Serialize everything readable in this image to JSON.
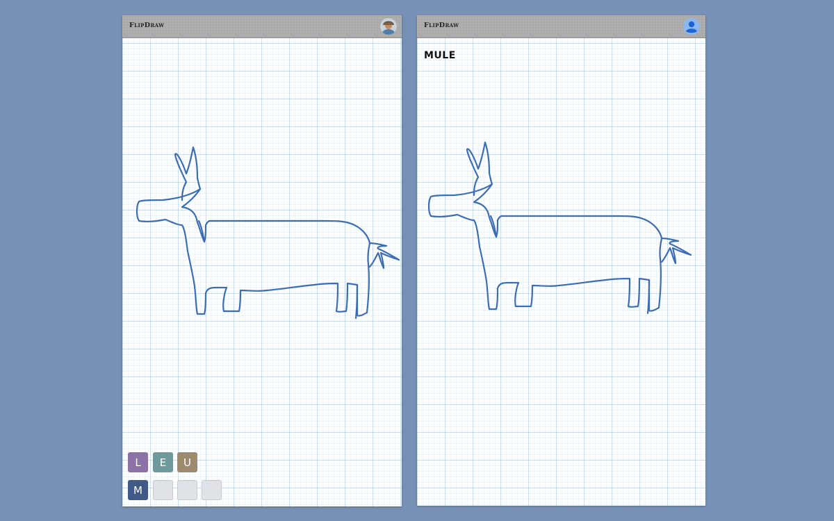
{
  "app": {
    "title": "FlipDraw"
  },
  "left_panel": {
    "avatar": "user-photo-avatar",
    "letter_rows": [
      [
        {
          "letter": "L",
          "color": "#8c72a6"
        },
        {
          "letter": "E",
          "color": "#6e9a9b"
        },
        {
          "letter": "U",
          "color": "#9e8b6f"
        }
      ],
      [
        {
          "letter": "M",
          "color": "#3f5a86"
        },
        {
          "letter": "",
          "color": "#dfe2e6"
        },
        {
          "letter": "",
          "color": "#dfe2e6"
        },
        {
          "letter": "",
          "color": "#dfe2e6"
        }
      ]
    ]
  },
  "right_panel": {
    "avatar": "default-user-avatar",
    "word": "MULE"
  },
  "colors": {
    "background": "#7790b5",
    "stroke": "#3c6db3",
    "topbar": "#a9a9a9"
  }
}
